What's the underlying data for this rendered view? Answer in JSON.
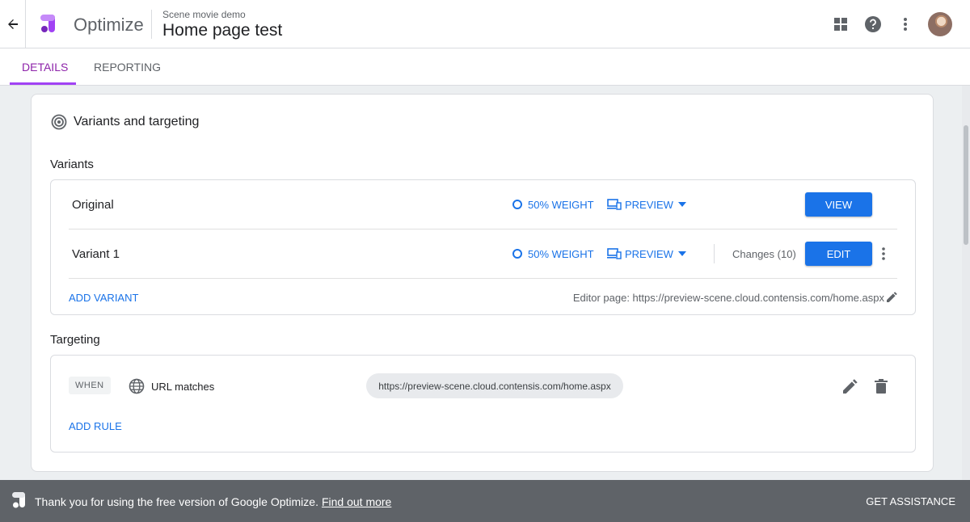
{
  "header": {
    "product": "Optimize",
    "breadcrumb_sub": "Scene movie demo",
    "page_title": "Home page test",
    "icons": [
      "back-arrow-icon",
      "apps-grid-icon",
      "help-icon",
      "more-vert-icon"
    ]
  },
  "tabs": [
    {
      "label": "Details",
      "active": true
    },
    {
      "label": "Reporting",
      "active": false
    }
  ],
  "section": {
    "title": "Variants and targeting"
  },
  "variants": {
    "label": "Variants",
    "rows": [
      {
        "name": "Original",
        "weight": "50% weight",
        "preview": "Preview",
        "action": "View"
      },
      {
        "name": "Variant 1",
        "weight": "50% weight",
        "preview": "Preview",
        "changes": "Changes (10)",
        "action": "Edit"
      }
    ],
    "add_label": "Add variant",
    "editor_page": "Editor page: https://preview-scene.cloud.contensis.com/home.aspx"
  },
  "targeting": {
    "label": "Targeting",
    "when": "WHEN",
    "condition": "URL matches",
    "url": "https://preview-scene.cloud.contensis.com/home.aspx",
    "add_rule": "Add rule"
  },
  "footer": {
    "message": "Thank you for using the free version of Google Optimize.",
    "link": "Find out more",
    "assistance": "Get assistance"
  },
  "colors": {
    "accent_blue": "#1a73e8",
    "tab_active": "#8e24aa",
    "footer_bg": "#5f6368"
  }
}
